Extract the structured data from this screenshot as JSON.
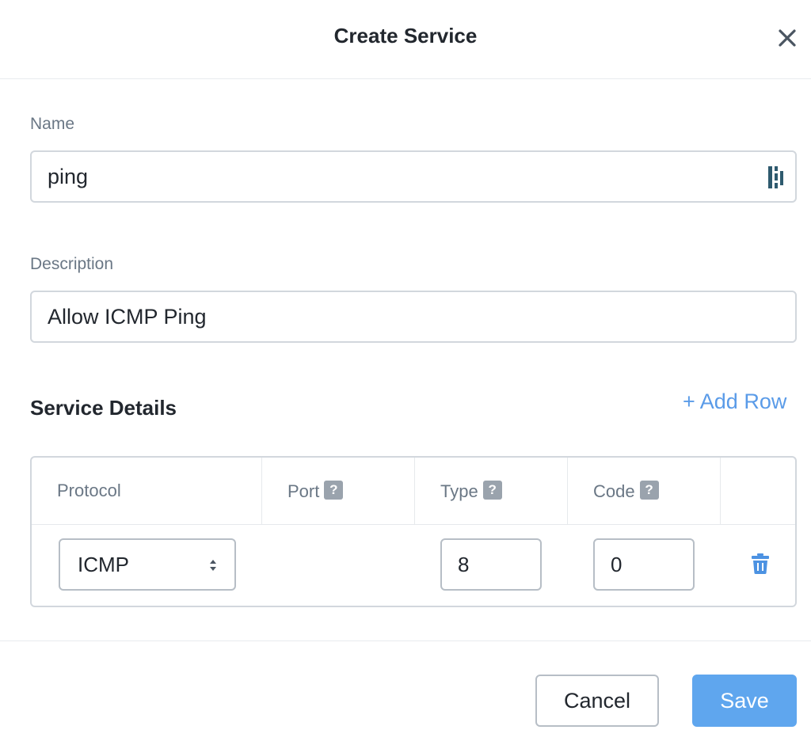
{
  "dialog": {
    "title": "Create Service",
    "close_icon": "close-icon"
  },
  "form": {
    "name_label": "Name",
    "name_value": "ping",
    "description_label": "Description",
    "description_value": "Allow ICMP Ping"
  },
  "service_details": {
    "title": "Service Details",
    "add_row_label": "+ Add Row",
    "columns": [
      "Protocol",
      "Port",
      "Type",
      "Code"
    ],
    "help_glyph": "?",
    "rows": [
      {
        "protocol": "ICMP",
        "port": "",
        "type": "8",
        "code": "0"
      }
    ]
  },
  "footer": {
    "cancel_label": "Cancel",
    "save_label": "Save"
  },
  "colors": {
    "accent": "#5a9be8",
    "save_bg": "#5fa6ee",
    "label": "#6a7785",
    "border": "#d2d7dd"
  }
}
